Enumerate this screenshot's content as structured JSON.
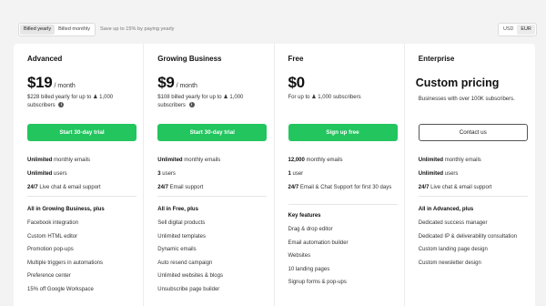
{
  "billing_toggle": {
    "yearly": "Billed yearly",
    "monthly": "Billed monthly"
  },
  "save_note": "Save up to 15% by paying yearly",
  "currency": {
    "usd": "USD",
    "eur": "EUR"
  },
  "plans": [
    {
      "name": "Advanced",
      "price": "$19",
      "per": "/ month",
      "sub_pre": "$228 billed yearly for up to",
      "sub_count": "1,000",
      "sub_post": "subscribers",
      "cta": "Start 30-day trial",
      "features": [
        {
          "strong": "Unlimited",
          "rest": " monthly emails"
        },
        {
          "strong": "Unlimited",
          "rest": " users"
        },
        {
          "strong": "24/7",
          "rest": " Live chat & email support"
        }
      ],
      "extras_title": "All in Growing Business, plus",
      "extras": [
        "Facebook integration",
        "Custom HTML editor",
        "Promotion pop-ups",
        "Multiple triggers in automations",
        "Preference center",
        "15% off Google Workspace"
      ]
    },
    {
      "name": "Growing Business",
      "price": "$9",
      "per": "/ month",
      "sub_pre": "$108 billed yearly for up to",
      "sub_count": "1,000",
      "sub_post": "subscribers",
      "cta": "Start 30-day trial",
      "features": [
        {
          "strong": "Unlimited",
          "rest": " monthly emails"
        },
        {
          "strong": "3",
          "rest": " users"
        },
        {
          "strong": "24/7",
          "rest": " Email support"
        }
      ],
      "extras_title": "All in Free, plus",
      "extras": [
        "Sell digital products",
        "Unlimited templates",
        "Dynamic emails",
        "Auto resend campaign",
        "Unlimited websites & blogs",
        "Unsubscribe page builder"
      ]
    },
    {
      "name": "Free",
      "price": "$0",
      "sub_pre": "For up to",
      "sub_count": "1,000",
      "sub_post": "subscribers",
      "cta": "Sign up free",
      "features": [
        {
          "strong": "12,000",
          "rest": " monthly emails"
        },
        {
          "strong": "1",
          "rest": " user"
        },
        {
          "strong": "24/7",
          "rest": " Email & Chat Support for first 30 days"
        }
      ],
      "extras_title": "Key features",
      "extras": [
        "Drag & drop editor",
        "Email automation builder",
        "Websites",
        "10 landing pages",
        "Signup forms & pop-ups"
      ]
    },
    {
      "name": "Enterprise",
      "custom_price": "Custom pricing",
      "sub_text": "Businesses with over 100K subscribers.",
      "cta": "Contact us",
      "features": [
        {
          "strong": "Unlimited",
          "rest": " monthly emails"
        },
        {
          "strong": "Unlimited",
          "rest": " users"
        },
        {
          "strong": "24/7",
          "rest": " Live chat & email support"
        }
      ],
      "extras_title": "All in Advanced, plus",
      "extras": [
        "Dedicated success manager",
        "Dedicated IP & deliverability consultation",
        "Custom landing page design",
        "Custom newsletter design"
      ]
    }
  ],
  "colors": {
    "accent": "#22c55e"
  },
  "icons": {
    "subscribers": "user-icon",
    "info": "info-icon"
  }
}
